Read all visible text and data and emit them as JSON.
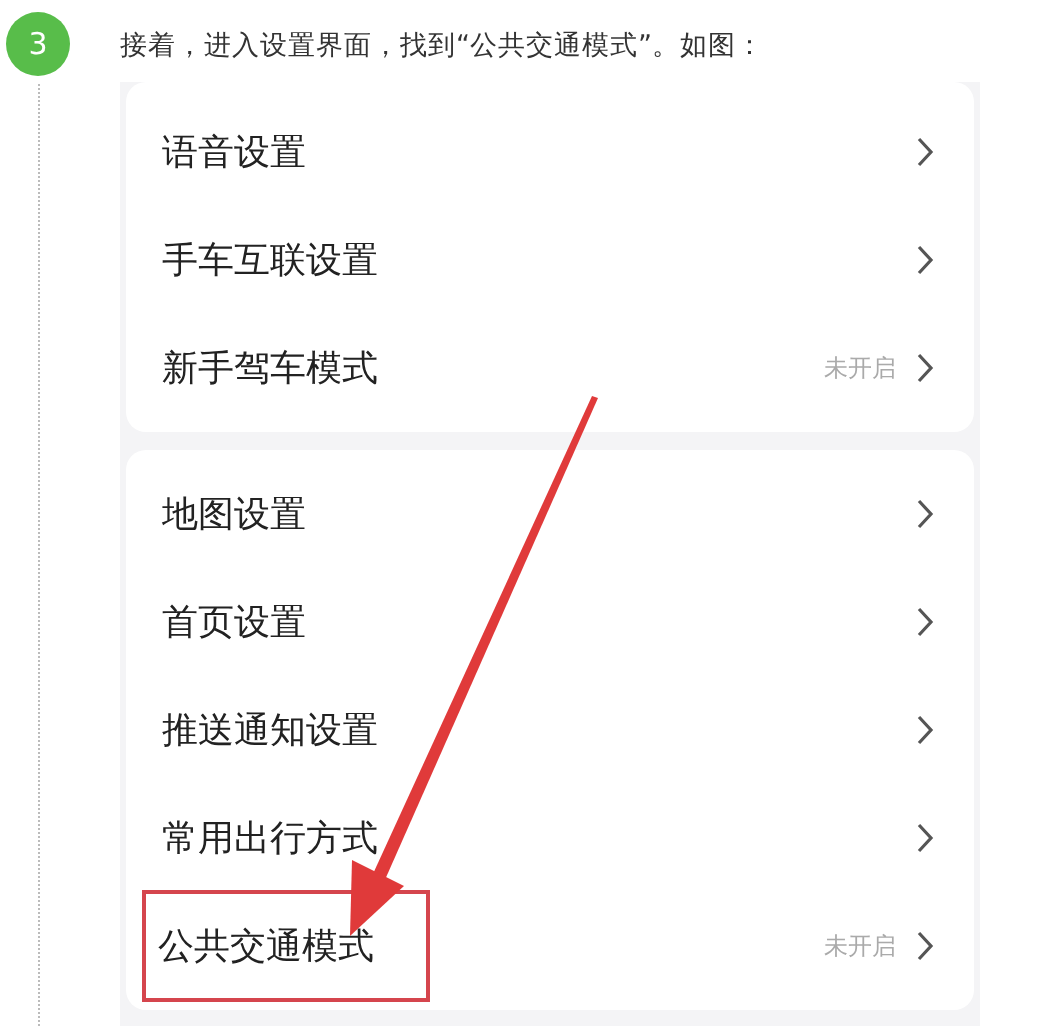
{
  "step": {
    "number": "3",
    "text": "接着，进入设置界面，找到“公共交通模式”。如图："
  },
  "groups": [
    {
      "items": [
        {
          "label": "语音设置",
          "highlighted": false
        },
        {
          "label": "手车互联设置",
          "highlighted": false
        },
        {
          "label": "新手驾车模式",
          "status": "未开启",
          "highlighted": false
        }
      ]
    },
    {
      "items": [
        {
          "label": "地图设置",
          "highlighted": false
        },
        {
          "label": "首页设置",
          "highlighted": false
        },
        {
          "label": "推送通知设置",
          "highlighted": false
        },
        {
          "label": "常用出行方式",
          "highlighted": false
        },
        {
          "label": "公共交通模式",
          "status": "未开启",
          "highlighted": true
        }
      ]
    }
  ]
}
